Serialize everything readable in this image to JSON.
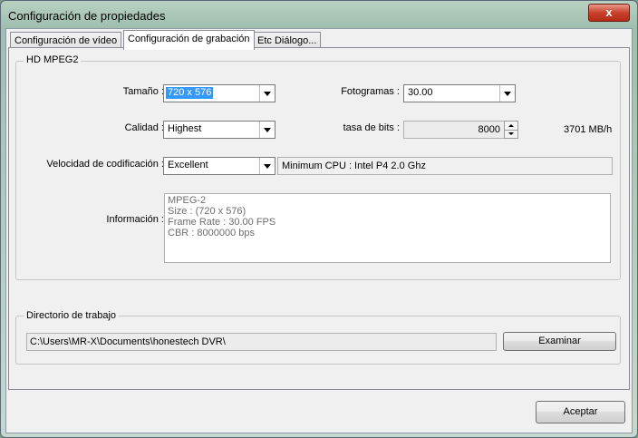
{
  "window": {
    "title": "Configuración de propiedades",
    "close_label": "x"
  },
  "tabs": [
    {
      "label": "Configuración de vídeo"
    },
    {
      "label": "Configuración de grabación"
    },
    {
      "label": "Etc Diálogo..."
    }
  ],
  "active_tab": 1,
  "group_hd": {
    "title": "HD MPEG2",
    "size_label": "Tamaño :",
    "size_value": "720 x 576",
    "fps_label": "Fotogramas :",
    "fps_value": "30.00",
    "quality_label": "Calidad :",
    "quality_value": "Highest",
    "bitrate_label": "tasa de bits :",
    "bitrate_value": "8000",
    "bitrate_rate": "3701 MB/h",
    "speed_label": "Velocidad de codificación :",
    "speed_value": "Excellent",
    "cpu_text": "Minimum CPU : Intel P4 2.0 Ghz",
    "info_label": "Información :",
    "info_lines": [
      "MPEG-2",
      "Size : (720 x 576)",
      "Frame Rate : 30.00 FPS",
      "CBR : 8000000 bps"
    ]
  },
  "group_dir": {
    "title": "Directorio de trabajo",
    "path": "C:\\Users\\MR-X\\Documents\\honestech DVR\\",
    "browse_label": "Examinar"
  },
  "ok_label": "Aceptar",
  "colors": {
    "selection": "#3399ff",
    "close_button": "#c8412b"
  }
}
